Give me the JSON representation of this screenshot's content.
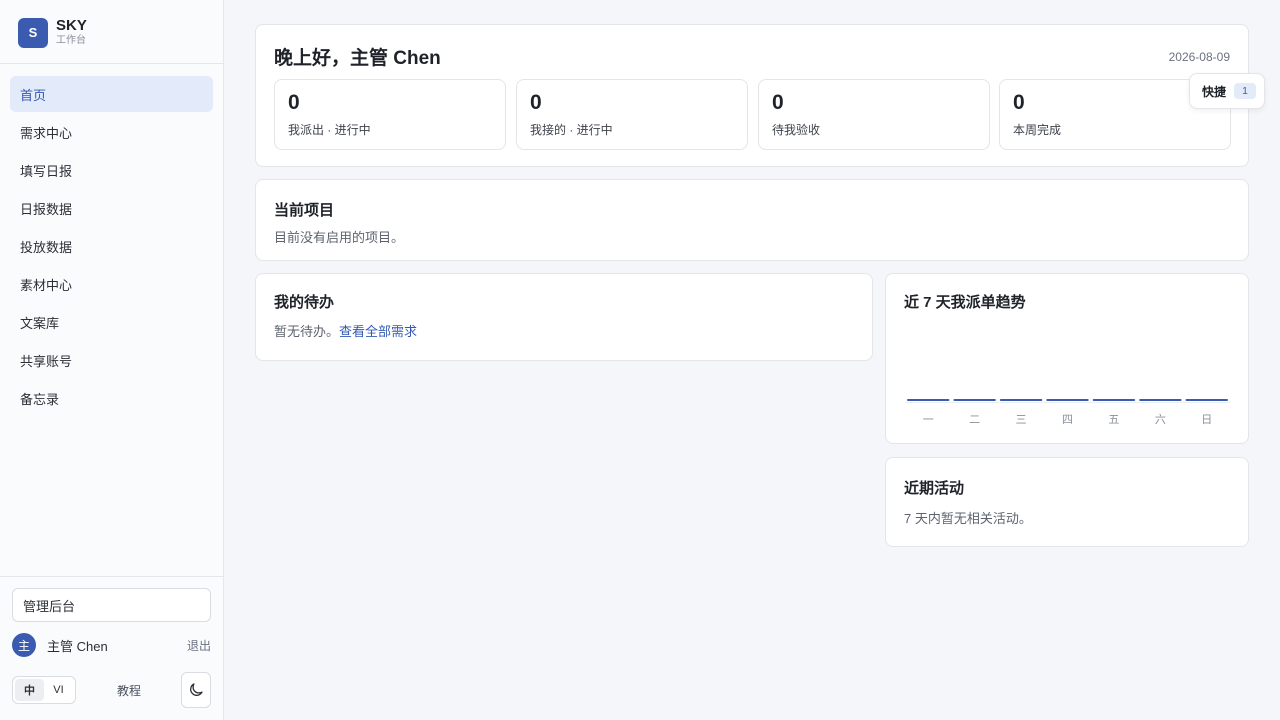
{
  "brand": {
    "logo_letter": "S",
    "name": "SKY",
    "subtitle": "工作台"
  },
  "nav": {
    "items": [
      {
        "label": "首页",
        "active": true
      },
      {
        "label": "需求中心"
      },
      {
        "label": "填写日报"
      },
      {
        "label": "日报数据"
      },
      {
        "label": "投放数据"
      },
      {
        "label": "素材中心"
      },
      {
        "label": "文案库"
      },
      {
        "label": "共享账号"
      },
      {
        "label": "备忘录"
      }
    ]
  },
  "sidebar_footer": {
    "admin_label": "管理后台",
    "user_avatar": "主",
    "user_name": "主管 Chen",
    "logout_label": "退出",
    "lang_zh": "中",
    "lang_vi": "VI",
    "tutorial_label": "教程",
    "theme_icon": "moon-icon"
  },
  "header": {
    "greeting": "晚上好，主管 Chen",
    "date": "2026-08-09"
  },
  "stats": [
    {
      "value": "0",
      "label": "我派出 · 进行中"
    },
    {
      "value": "0",
      "label": "我接的 · 进行中"
    },
    {
      "value": "0",
      "label": "待我验收"
    },
    {
      "value": "0",
      "label": "本周完成"
    }
  ],
  "quick": {
    "label": "快捷",
    "count": "1"
  },
  "project": {
    "title": "当前项目",
    "empty_text": "目前没有启用的项目。"
  },
  "todo": {
    "title": "我的待办",
    "empty_text": "暂无待办。",
    "link_text": "查看全部需求"
  },
  "activity": {
    "title": "近期活动",
    "empty_text": "7 天内暂无相关活动。"
  },
  "colors": {
    "accent": "#3a5bb0",
    "bar": "#3a5bb0"
  },
  "chart_data": {
    "type": "bar",
    "title": "近 7 天我派单趋势",
    "categories": [
      "一",
      "二",
      "三",
      "四",
      "五",
      "六",
      "日"
    ],
    "values": [
      0,
      0,
      0,
      0,
      0,
      0,
      0
    ]
  }
}
